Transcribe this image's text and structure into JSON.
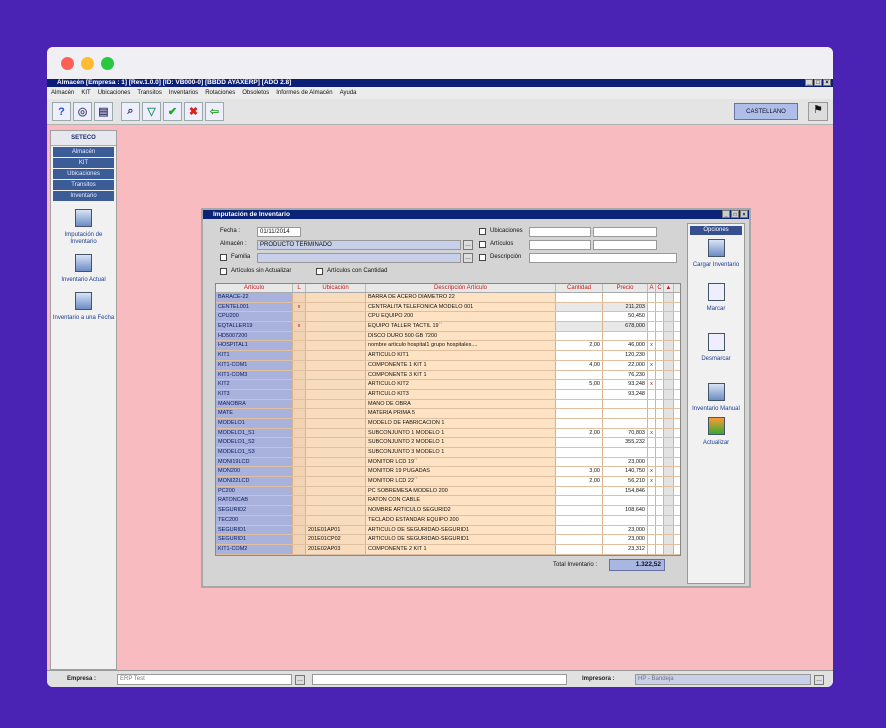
{
  "app": {
    "title": "Almacén [Empresa : 1] [Rev.1.0.0] [ID: VB000-0] [BBDD AYAXERP] [ADO 2.8]",
    "menu": [
      "Almacén",
      "KIT",
      "Ubicaciones",
      "Transitos",
      "Inventarios",
      "Rotaciones",
      "Obsoletos",
      "Informes de Almacén",
      "Ayuda"
    ],
    "language": "CASTELLANO"
  },
  "sidebar": {
    "header": "SETECO",
    "items": [
      "Almacén",
      "KIT",
      "Ubicaciones",
      "Transitos",
      "Inventario"
    ],
    "options": [
      "Imputación de Inventario",
      "Inventario Actual",
      "Inventario a una Fecha"
    ]
  },
  "status": {
    "empresa_label": "Empresa :",
    "empresa_value": "ERP Test",
    "impresora_label": "Impresora :",
    "impresora_value": "HP - Bandeja"
  },
  "dialog": {
    "title": "Imputación de Inventario",
    "fecha_label": "Fecha :",
    "fecha_value": "01/11/2014",
    "almacen_label": "Almacén :",
    "almacen_value": "PRODUCTO TERMINADO",
    "familia_label": "Familia",
    "sin_actualizar_label": "Artículos sin Actualizar",
    "con_cantidad_label": "Artículos con Cantidad",
    "ubicaciones_label": "Ubicaciones",
    "articulos_label": "Artículos",
    "descripcion_label": "Descripción",
    "columns": [
      "Artículo",
      "L",
      "Ubicación",
      "Descripción Artículo",
      "Cantidad",
      "Precio",
      "A",
      "C"
    ],
    "rows": [
      [
        "BARACE-22",
        "",
        "",
        "BARRA DE ACERO DIAMETRO 22",
        "",
        "",
        ""
      ],
      [
        "CENTEL001",
        "x",
        "",
        "CENTRALITA TELEFONICA MODELO 001",
        "",
        "211,203",
        ""
      ],
      [
        "CPU200",
        "",
        "",
        "CPU EQUIPO 200",
        "",
        "50,450",
        ""
      ],
      [
        "EQTALLER19",
        "x",
        "",
        "EQUIPO TALLER TACTIL 19´´",
        "",
        "678,000",
        ""
      ],
      [
        "HD5007200",
        "",
        "",
        "DISCO DURO 500 GB 7200",
        "",
        "",
        ""
      ],
      [
        "HOSPITAL1",
        "",
        "",
        "nombre articulo hospital1 grupo hospitales....",
        "2,00",
        "46,000",
        "x"
      ],
      [
        "KIT1",
        "",
        "",
        "ARTICULO KIT1",
        "",
        "120,230",
        ""
      ],
      [
        "KIT1-COM1",
        "",
        "",
        "COMPONENTE 1 KIT 1",
        "4,00",
        "22,000",
        "x"
      ],
      [
        "KIT1-COM3",
        "",
        "",
        "COMPONENTE 3 KIT 1",
        "",
        "76,230",
        ""
      ],
      [
        "KIT2",
        "",
        "",
        "ARTICULO KIT2",
        "5,00",
        "93,248",
        "x"
      ],
      [
        "KIT3",
        "",
        "",
        "ARTICULO KIT3",
        "",
        "93,248",
        ""
      ],
      [
        "MANOBRA",
        "",
        "",
        "MANO DE OBRA",
        "",
        "",
        ""
      ],
      [
        "MATE",
        "",
        "",
        "MATERIA PRIMA 5",
        "",
        "",
        ""
      ],
      [
        "MODELO1",
        "",
        "",
        "MODELO DE FABRICACION 1",
        "",
        "",
        ""
      ],
      [
        "MODELO1_S1",
        "",
        "",
        "SUBCONJUNTO 1 MODELO 1",
        "2,00",
        "70,803",
        "x"
      ],
      [
        "MODELO1_S2",
        "",
        "",
        "SUBCONJUNTO 2 MODELO 1",
        "",
        "355,232",
        ""
      ],
      [
        "MODELO1_S3",
        "",
        "",
        "SUBCONJUNTO 3 MODELO 1",
        "",
        "",
        ""
      ],
      [
        "MONI19LCD",
        "",
        "",
        "MONITOR LCD 19´´",
        "",
        "23,000",
        ""
      ],
      [
        "MON200",
        "",
        "",
        "MONITOR 19 PUGADAS",
        "3,00",
        "140,750",
        "x"
      ],
      [
        "MONI22LCD",
        "",
        "",
        "MONITOR LCD 22´´",
        "2,00",
        "56,210",
        "x"
      ],
      [
        "PC200",
        "",
        "",
        "PC SOBREMESA MODELO 200",
        "",
        "154,846",
        ""
      ],
      [
        "RATONCAB",
        "",
        "",
        "RATON CON CABLE",
        "",
        "",
        ""
      ],
      [
        "SEGURID2",
        "",
        "",
        "NOMBRE ARTICULO SEGURID2",
        "",
        "108,640",
        ""
      ],
      [
        "TEC200",
        "",
        "",
        "TECLADO ESTANDAR EQUIPO 200",
        "",
        "",
        ""
      ],
      [
        "SEGURID1",
        "",
        "201E01AP01",
        "ARTICULO DE SEGURIDAD-SEGURID1",
        "",
        "23,000",
        ""
      ],
      [
        "SEGURID1",
        "",
        "201E01CP02",
        "ARTICULO DE SEGURIDAD-SEGURID1",
        "",
        "23,000",
        ""
      ],
      [
        "KIT1-COM2",
        "",
        "201E02AP03",
        "COMPONENTE 2 KIT 1",
        "",
        "23,312",
        ""
      ]
    ],
    "total_label": "Total Inventario :",
    "total_value": "1.322,52"
  },
  "options_panel": {
    "header": "Opciones",
    "items": [
      "Cargar Inventario",
      "Marcar",
      "Desmarcar",
      "Inventario Manual",
      "Actualizar"
    ]
  }
}
